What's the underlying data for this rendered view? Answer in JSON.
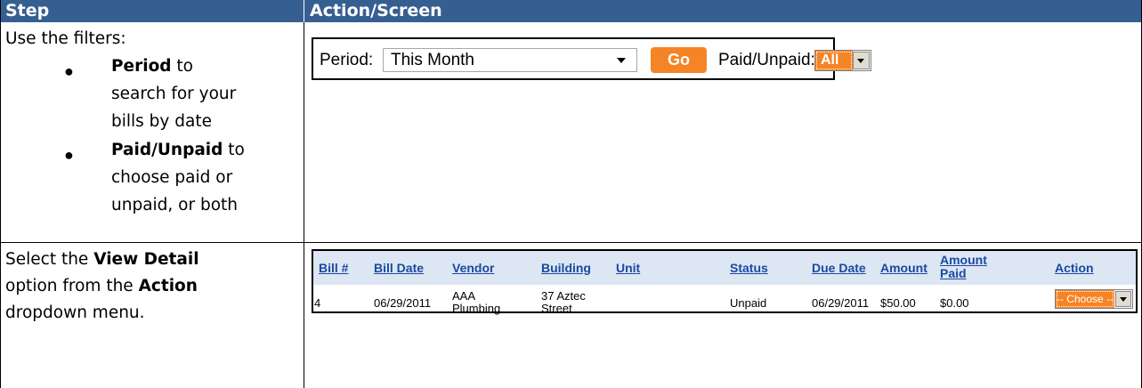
{
  "table": {
    "headers": [
      "Step",
      "Action/Screen"
    ]
  },
  "row1": {
    "intro": "Use the filters:",
    "bullet1_bold": "Period",
    "bullet1_rest_a": " to",
    "bullet1_rest_b": "search for your",
    "bullet1_rest_c": "bills by date",
    "bullet2_bold": "Paid/Unpaid",
    "bullet2_rest_a": " to",
    "bullet2_rest_b": "choose paid or",
    "bullet2_rest_c": "unpaid, or both"
  },
  "filters": {
    "period_label": "Period:",
    "period_value": "This Month",
    "go_label": "Go",
    "paid_label": "Paid/Unpaid:",
    "paid_value": "All",
    "accent": "#f58426"
  },
  "row2": {
    "t1": "Select the ",
    "t1_bold": "View Detail",
    "t2": "option from the ",
    "t2_bold": "Action",
    "t3": "dropdown menu."
  },
  "bills": {
    "columns": [
      "Bill #",
      "Bill Date",
      "Vendor",
      "Building",
      "Unit",
      "Status",
      "Due Date",
      "Amount",
      "Amount",
      "Paid",
      "Action"
    ],
    "row": {
      "bill_no": "4",
      "bill_date": "06/29/2011",
      "vendor_a": "AAA",
      "vendor_b": "Plumbing",
      "building_a": "37 Aztec",
      "building_b": "Street",
      "unit": "",
      "status": "Unpaid",
      "due_date": "06/29/2011",
      "amount": "$50.00",
      "amount_paid": "$0.00",
      "action_value": "-- Choose --"
    },
    "link_color": "#1a4aa0"
  },
  "colors": {
    "header_bg": "#365f91"
  }
}
